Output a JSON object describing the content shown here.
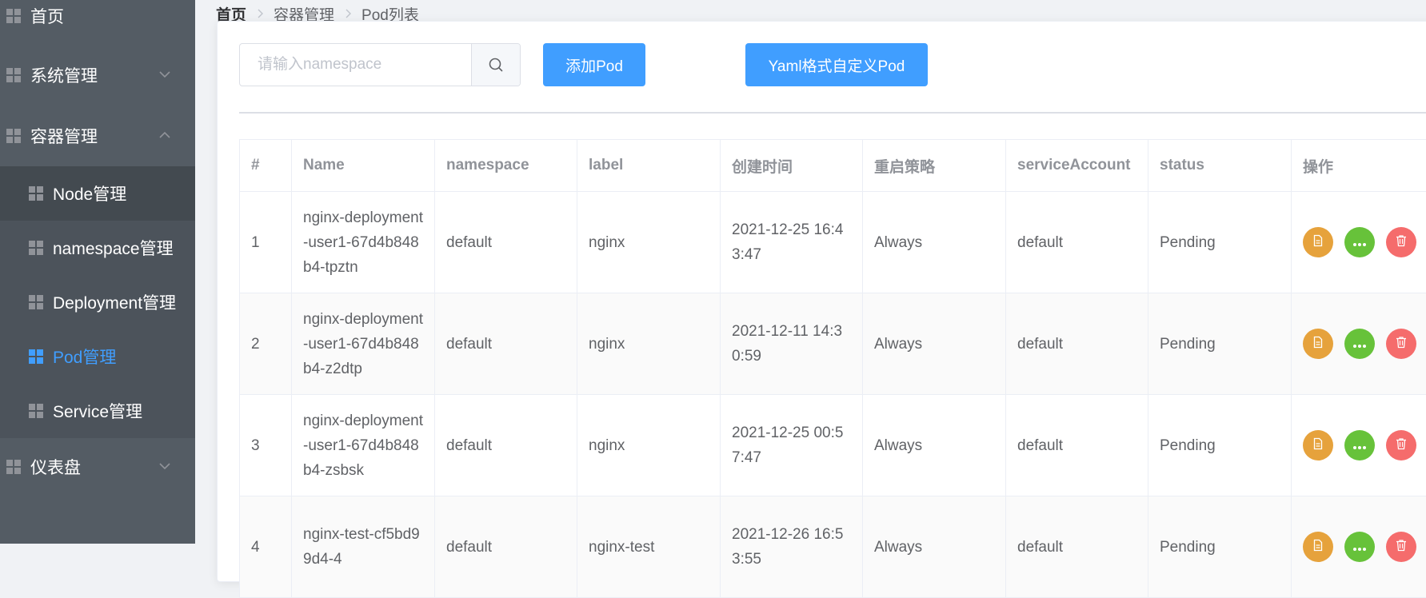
{
  "sidebar": {
    "items": [
      {
        "label": "首页"
      },
      {
        "label": "系统管理"
      },
      {
        "label": "容器管理"
      },
      {
        "label": "Node管理"
      },
      {
        "label": "namespace管理"
      },
      {
        "label": "Deployment管理"
      },
      {
        "label": "Pod管理"
      },
      {
        "label": "Service管理"
      },
      {
        "label": "仪表盘"
      }
    ],
    "active": "Pod管理"
  },
  "breadcrumb": [
    "首页",
    "容器管理",
    "Pod列表"
  ],
  "toolbar": {
    "search_placeholder": "请输入namespace",
    "search_value": "",
    "add_label": "添加Pod",
    "yaml_label": "Yaml格式自定义Pod"
  },
  "table": {
    "headers": [
      "#",
      "Name",
      "namespace",
      "label",
      "创建时间",
      "重启策略",
      "serviceAccount",
      "status",
      "操作"
    ],
    "rows": [
      {
        "idx": "1",
        "name": "nginx-deployment-user1-67d4b848b4-tpztn",
        "namespace": "default",
        "label": "nginx",
        "created": "2021-12-25 16:43:47",
        "restart": "Always",
        "sa": "default",
        "status": "Pending"
      },
      {
        "idx": "2",
        "name": "nginx-deployment-user1-67d4b848b4-z2dtp",
        "namespace": "default",
        "label": "nginx",
        "created": "2021-12-11 14:30:59",
        "restart": "Always",
        "sa": "default",
        "status": "Pending"
      },
      {
        "idx": "3",
        "name": "nginx-deployment-user1-67d4b848b4-zsbsk",
        "namespace": "default",
        "label": "nginx",
        "created": "2021-12-25 00:57:47",
        "restart": "Always",
        "sa": "default",
        "status": "Pending"
      },
      {
        "idx": "4",
        "name": "nginx-test-cf5bd99d4-4",
        "namespace": "default",
        "label": "nginx-test",
        "created": "2021-12-26 16:53:55",
        "restart": "Always",
        "sa": "default",
        "status": "Pending"
      }
    ]
  },
  "colors": {
    "sidebar_bg": "#545c64",
    "active": "#409eff",
    "warning": "#e6a23c",
    "success": "#67c23a",
    "danger": "#f56c6c"
  }
}
